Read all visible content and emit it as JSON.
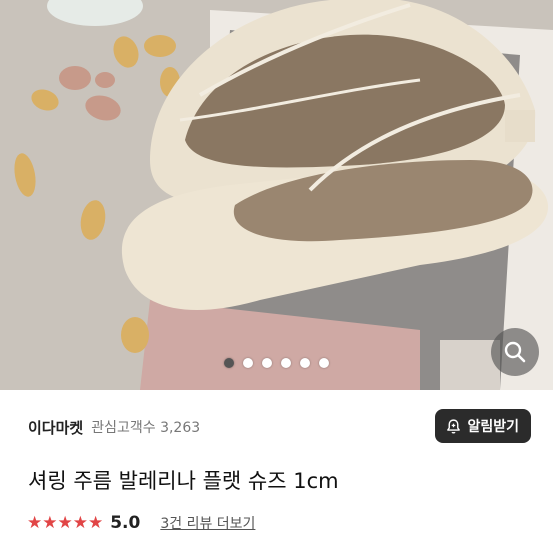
{
  "product": {
    "image_alt": "",
    "carousel": {
      "total": 6,
      "active_index": 0
    }
  },
  "seller": {
    "name": "이다마켓",
    "favorites_label": "관심고객수",
    "favorites_count": "3,263",
    "notify_label": "알림받기"
  },
  "title": "셔링 주름 발레리나 플랫 슈즈 1cm",
  "rating": {
    "stars": "★★★★★",
    "score": "5.0",
    "review_link": "3건 리뷰 더보기"
  },
  "icons": {
    "zoom": "search-icon",
    "notify": "bell-plus-icon"
  },
  "colors": {
    "star": "#e14546",
    "button_dark": "#2b2b2b"
  }
}
